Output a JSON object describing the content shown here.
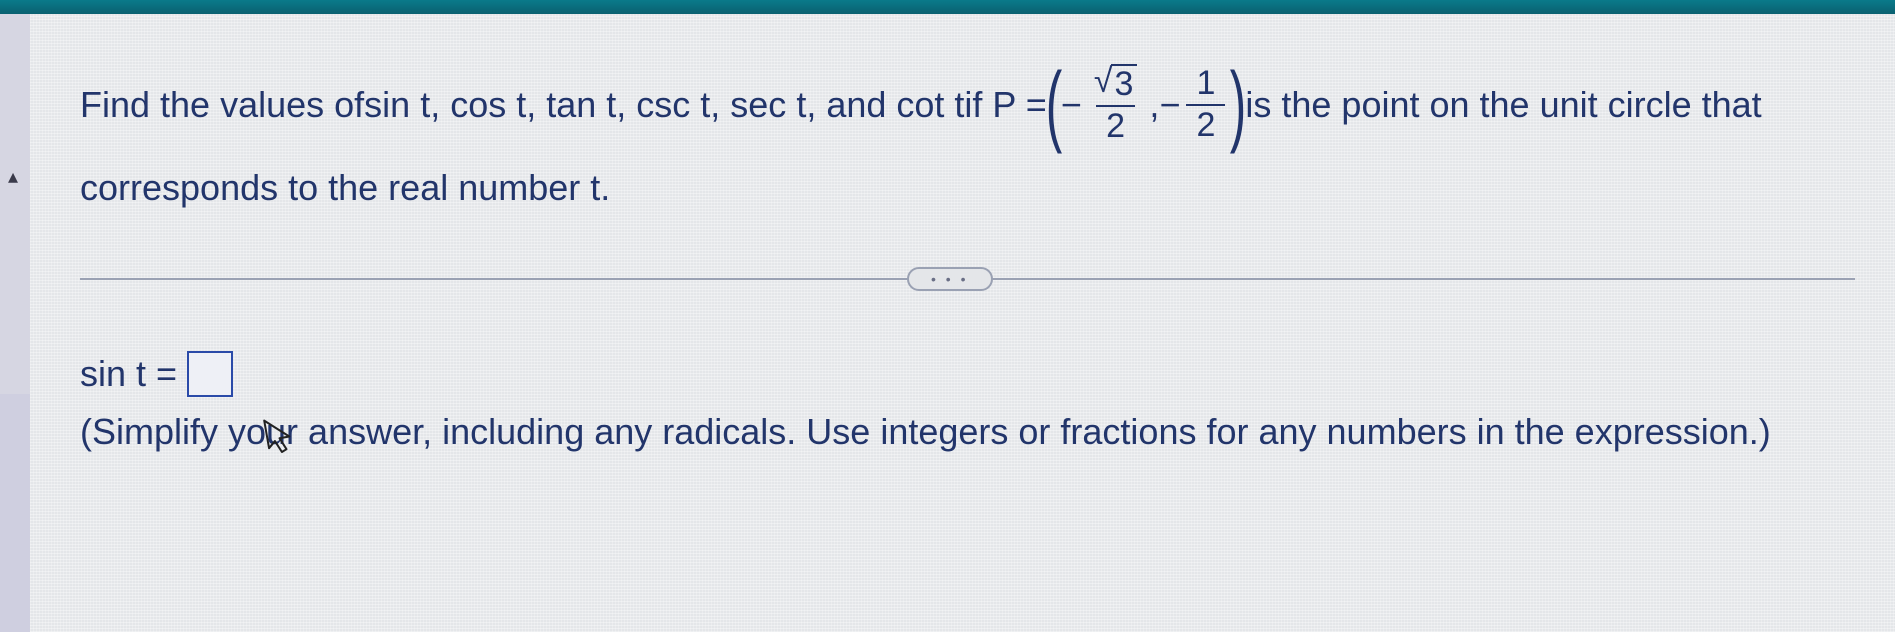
{
  "question": {
    "lead": "Find the values of ",
    "funcs": "sin t, cos t, tan t, csc t, sec t, and cot t",
    "if": " if P = ",
    "point_x_sign": "−",
    "point_x_num_rad": "3",
    "point_x_den": "2",
    "comma": " , ",
    "point_y_sign": "−",
    "point_y_num": "1",
    "point_y_den": "2",
    "tail": " is the point on the unit circle that",
    "line2": "corresponds to the real number t."
  },
  "divider": {
    "dots": "• • •"
  },
  "answer": {
    "label": "sin t =",
    "value": ""
  },
  "instruction": "(Simplify your answer, including any radicals. Use integers or fractions for any numbers in the expression.)"
}
